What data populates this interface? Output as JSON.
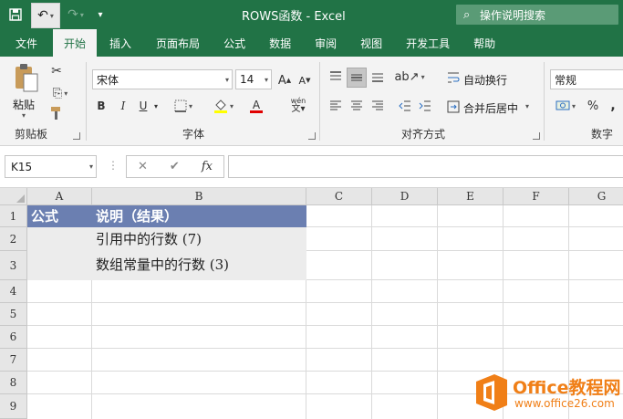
{
  "app": {
    "title": "ROWS函数  -  Excel",
    "tell_me": "操作说明搜索"
  },
  "ribbon_tabs": [
    "文件",
    "开始",
    "插入",
    "页面布局",
    "公式",
    "数据",
    "审阅",
    "视图",
    "开发工具",
    "帮助"
  ],
  "ribbon": {
    "clipboard": {
      "paste_label": "粘贴",
      "group_label": "剪贴板"
    },
    "font": {
      "font_name": "宋体",
      "font_size": "14",
      "group_label": "字体",
      "bold": "B",
      "italic": "I",
      "underline": "U",
      "grow": "A",
      "shrink": "A",
      "font_color_letter": "A",
      "phonetic": "wén"
    },
    "alignment": {
      "wrap_text": "自动换行",
      "merge_center": "合并后居中",
      "group_label": "对齐方式"
    },
    "number": {
      "format": "常规",
      "percent": "%",
      "comma": ",",
      "group_label": "数字"
    }
  },
  "formula_bar": {
    "name_box": "K15",
    "cancel": "✕",
    "enter": "✔",
    "fx": "fx",
    "value": ""
  },
  "sheet": {
    "columns": [
      "A",
      "B",
      "C",
      "D",
      "E",
      "F",
      "G"
    ],
    "rows": [
      "1",
      "2",
      "3",
      "4",
      "5",
      "6",
      "7",
      "8",
      "9"
    ],
    "cells": {
      "A1": "公式",
      "B1": "说明（结果）",
      "B2": "引用中的行数 (7)",
      "B3": "数组常量中的行数 (3)"
    }
  },
  "watermark": {
    "title": "Office教程网",
    "url": "www.office26.com"
  },
  "colors": {
    "excel_green": "#217346",
    "header_fill": "#6b7fb1",
    "shade_fill": "#ececec",
    "watermark_orange": "#f07f17"
  }
}
